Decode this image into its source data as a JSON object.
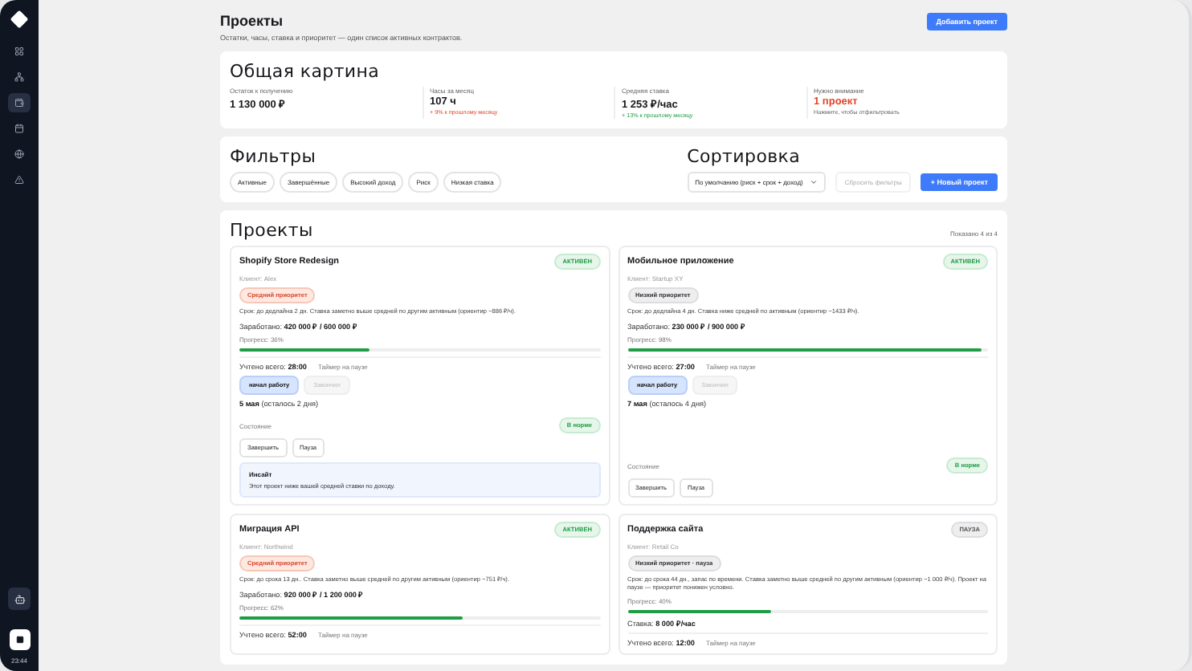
{
  "sidebar": {
    "items": [
      {
        "selected": false
      },
      {
        "selected": false
      },
      {
        "selected": true
      },
      {
        "selected": false
      },
      {
        "selected": false
      },
      {
        "selected": false
      }
    ],
    "time": "23:44"
  },
  "header": {
    "title": "Проекты",
    "subtitle": "Остатки, часы, ставка и приоритет — один список активных контрактов.",
    "action": "Добавить проект"
  },
  "overview": {
    "title": "Общая картина",
    "stats": [
      {
        "label": "Остаток к получению",
        "value": "1 130 000 ₽",
        "kind": "plain"
      },
      {
        "label": "Часы за месяц",
        "value": "107 ч",
        "note": "+ 9% к прошлому месяцу",
        "kind": "worse"
      },
      {
        "label": "Средняя ставка",
        "value": "1 253 ₽/час",
        "note": "+ 13% к прошлому месяцу",
        "kind": "better"
      },
      {
        "label": "Нужно внимание",
        "value": "1 проект",
        "note": "Нажмите, чтобы отфильтровать",
        "kind": "alert"
      }
    ]
  },
  "filters": {
    "title": "Фильтры",
    "chips": [
      "Активные",
      "Завершённые",
      "Высокий доход",
      "Риск",
      "Низкая ставка"
    ]
  },
  "sorting": {
    "title": "Сортировка",
    "select": "По умолчанию (риск + срок + доход)",
    "reset": "Сбросить фильтры",
    "new": "+ Новый проект"
  },
  "projects": {
    "title": "Проекты",
    "count": "Показано 4 из 4",
    "items": [
      {
        "name": "Shopify Store Redesign",
        "client": "Клиент: Alex",
        "status": {
          "label": "АКТИВЕН",
          "kind": "active"
        },
        "priority": {
          "label": "Средний приоритет",
          "kind": "medium"
        },
        "desc": "Срок: до дедлайна 2 дн. Ставка заметно выше средней по другим активным (ориентир ~886 ₽/ч).",
        "earned_label": "Заработано:",
        "earned": "420 000 ₽ / 600 000 ₽",
        "progress": "Прогресс: 36%",
        "level": 0.36,
        "tracked_label": "Учтено всего:",
        "tracked": "28:00",
        "timer": "Таймер на паузе",
        "timer_buttons": [
          {
            "label": "начал работу",
            "disabled": false
          },
          {
            "label": "Закончил",
            "disabled": true
          }
        ],
        "deadline": "5 мая",
        "deadline_note": "(осталось 2 дня)",
        "state_label": "Состояние",
        "state": "В норме",
        "actions": [
          "Завершить",
          "Пауза"
        ],
        "insight": {
          "title": "Инсайт",
          "text": "Этот проект ниже вашей средней ставки по доходу."
        }
      },
      {
        "name": "Мобильное приложение",
        "client": "Клиент: Startup XY",
        "status": {
          "label": "АКТИВЕН",
          "kind": "active"
        },
        "priority": {
          "label": "Низкий приоритет",
          "kind": "low"
        },
        "desc": "Срок: до дедлайна 4 дн. Ставка ниже средней по активным (ориентир ~1433 ₽/ч).",
        "earned_label": "Заработано:",
        "earned": "230 000 ₽ / 900 000 ₽",
        "progress": "Прогресс: 98%",
        "level": 0.98,
        "tracked_label": "Учтено всего:",
        "tracked": "27:00",
        "timer": "Таймер на паузе",
        "timer_buttons": [
          {
            "label": "начал работу",
            "disabled": false
          },
          {
            "label": "Закончил",
            "disabled": true
          }
        ],
        "deadline": "7 мая",
        "deadline_note": "(осталось 4 дня)",
        "state_label": "Состояние",
        "state": "В норме",
        "actions": [
          "Завершить",
          "Пауза"
        ]
      },
      {
        "name": "Миграция API",
        "client": "Клиент: Northwind",
        "status": {
          "label": "АКТИВЕН",
          "kind": "active"
        },
        "priority": {
          "label": "Средний приоритет",
          "kind": "medium"
        },
        "desc": "Срок: до срока 13 дн.. Ставка заметно выше средней по другим активным (ориентир ~751 ₽/ч).",
        "earned_label": "Заработано:",
        "earned": "920 000 ₽ / 1 200 000 ₽",
        "progress": "Прогресс: 62%",
        "level": 0.62,
        "tracked_label": "Учтено всего:",
        "tracked": "52:00",
        "timer": "Таймер на паузе"
      },
      {
        "name": "Поддержка сайта",
        "client": "Клиент: Retail Co",
        "status": {
          "label": "ПАУЗА",
          "kind": "paused"
        },
        "priority": {
          "label": "Низкий приоритет · пауза",
          "kind": "low"
        },
        "desc": "Срок: до срока 44 дн., запас по времени. Ставка заметно выше средней по другим активным (ориентир ~1 000 ₽/ч). Проект на паузе — приоритет понижен условно.",
        "progress": "Прогресс: 40%",
        "level": 0.4,
        "rate_label": "Ставка:",
        "rate": "8 000 ₽/час",
        "tracked_label": "Учтено всего:",
        "tracked": "12:00",
        "timer": "Таймер на паузе"
      }
    ]
  }
}
